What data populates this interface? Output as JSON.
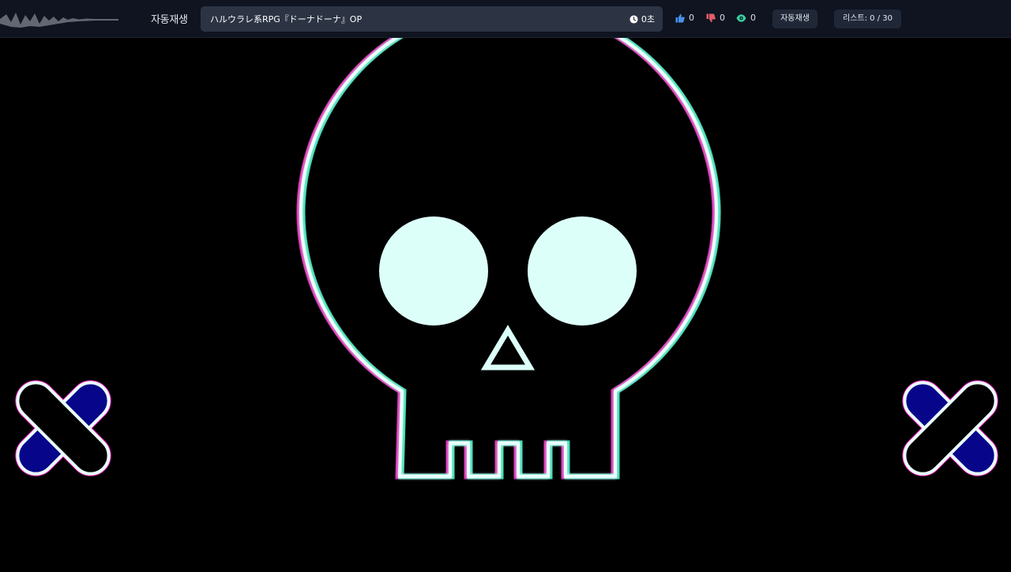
{
  "header": {
    "autoplay_label": "자동재생",
    "now_playing_title": "ハルウラレ系RPG『ドーナドーナ』OP",
    "elapsed": "0초",
    "likes": "0",
    "dislikes": "0",
    "views": "0",
    "autoplay_button": "자동재생",
    "playlist_counter": "리스트: 0 / 30"
  },
  "colors": {
    "topbar_bg": "#0f1420",
    "title_box_bg": "#2c3444",
    "like_icon": "#4a8fe8",
    "dislike_icon": "#e35d6a",
    "view_icon": "#3ad29f",
    "skull_glow": "#7ff5dc",
    "bandage_fill": "#0a0a8c"
  },
  "icons": {
    "clock": "clock-icon",
    "like": "thumbs-up-icon",
    "dislike": "thumbs-down-icon",
    "view": "eye-icon"
  }
}
